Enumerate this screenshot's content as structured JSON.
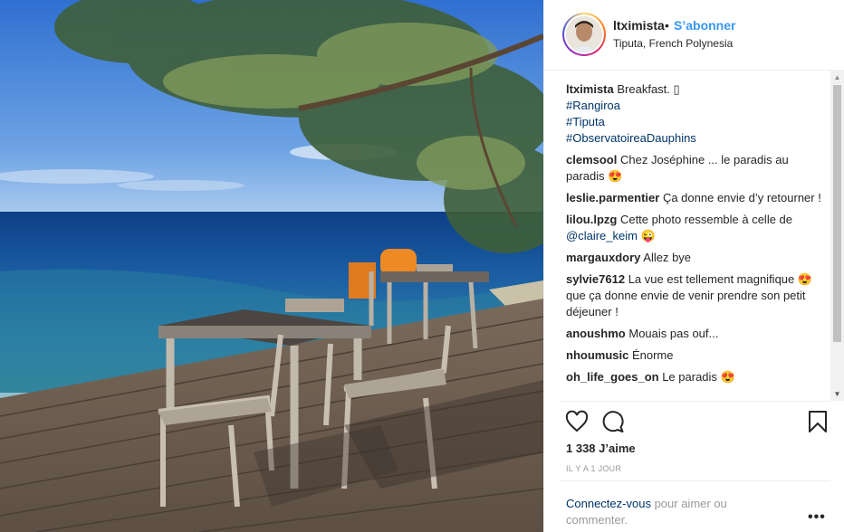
{
  "header": {
    "username": "ltximista",
    "separator": "•",
    "follow_label": "S’abonner",
    "location": "Tiputa, French Polynesia"
  },
  "caption": {
    "username": "ltximista",
    "text": "Breakfast. ",
    "emoji": "▯",
    "hashtags": [
      "#Rangiroa",
      "#Tiputa",
      "#ObservatoireaDauphins"
    ]
  },
  "comments": [
    {
      "user": "clemsool",
      "text": "Chez Joséphine ... le paradis au paradis 😍"
    },
    {
      "user": "leslie.parmentier",
      "text": "Ça donne envie d’y retourner !"
    },
    {
      "user": "lilou.lpzg",
      "text": "Cette photo ressemble à celle de ",
      "mention": "@claire_keim",
      "after": " 😜"
    },
    {
      "user": "margauxdory",
      "text": "Allez bye"
    },
    {
      "user": "sylvie7612",
      "text": "La vue est tellement magnifique 😍 que ça donne envie de venir prendre son petit déjeuner !"
    },
    {
      "user": "anoushmo",
      "text": "Mouais pas ouf..."
    },
    {
      "user": "nhoumusic",
      "text": "Énorme"
    },
    {
      "user": "oh_life_goes_on",
      "text": "Le paradis 😍"
    }
  ],
  "actions": {
    "like_icon": "heart-icon",
    "comment_icon": "comment-bubble-icon",
    "save_icon": "bookmark-icon"
  },
  "likes": "1 338 J’aime",
  "time_ago": "IL Y A 1 JOUR",
  "login_prompt": {
    "link": "Connectez-vous",
    "rest": " pour aimer ou commenter."
  },
  "more_options": "•••",
  "colors": {
    "link_blue": "#3897f0",
    "dark_link": "#003569",
    "muted": "#999999"
  }
}
